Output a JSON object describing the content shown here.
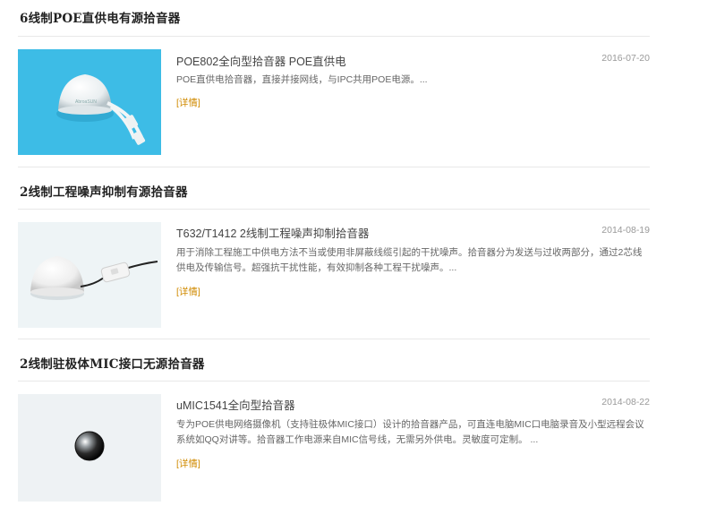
{
  "sections": [
    {
      "title": "6线制POE直供电有源拾音器",
      "product": {
        "name": "POE802全向型拾音器 POE直供电",
        "date": "2016-07-20",
        "description": "POE直供电拾音器，直接并接网线，与IPC共用POE电源。...",
        "detail_label": "[详情]",
        "image_bg": "#3dbce6"
      }
    },
    {
      "title": "2线制工程噪声抑制有源拾音器",
      "product": {
        "name": "T632/T1412 2线制工程噪声抑制拾音器",
        "date": "2014-08-19",
        "description": "用于消除工程施工中供电方法不当或使用非屏蔽线缆引起的干扰噪声。拾音器分为发送与过收两部分，通过2芯线供电及传输信号。超强抗干扰性能，有效抑制各种工程干扰噪声。...",
        "detail_label": "[详情]",
        "image_bg": "#eef4f6"
      }
    },
    {
      "title": "2线制驻极体MIC接口无源拾音器",
      "product": {
        "name": "uMIC1541全向型拾音器",
        "date": "2014-08-22",
        "description": "专为POE供电网络摄像机（支持驻极体MIC接口）设计的拾音器产品，可直连电脑MIC口电脑录音及小型远程会议系统如QQ对讲等。拾音器工作电源来自MIC信号线，无需另外供电。灵敏度可定制。 ...",
        "detail_label": "[详情]",
        "image_bg": "#eef2f4"
      }
    }
  ],
  "colors": {
    "link": "#d08a00",
    "date": "#999999",
    "rule": "#e8e8e8"
  }
}
